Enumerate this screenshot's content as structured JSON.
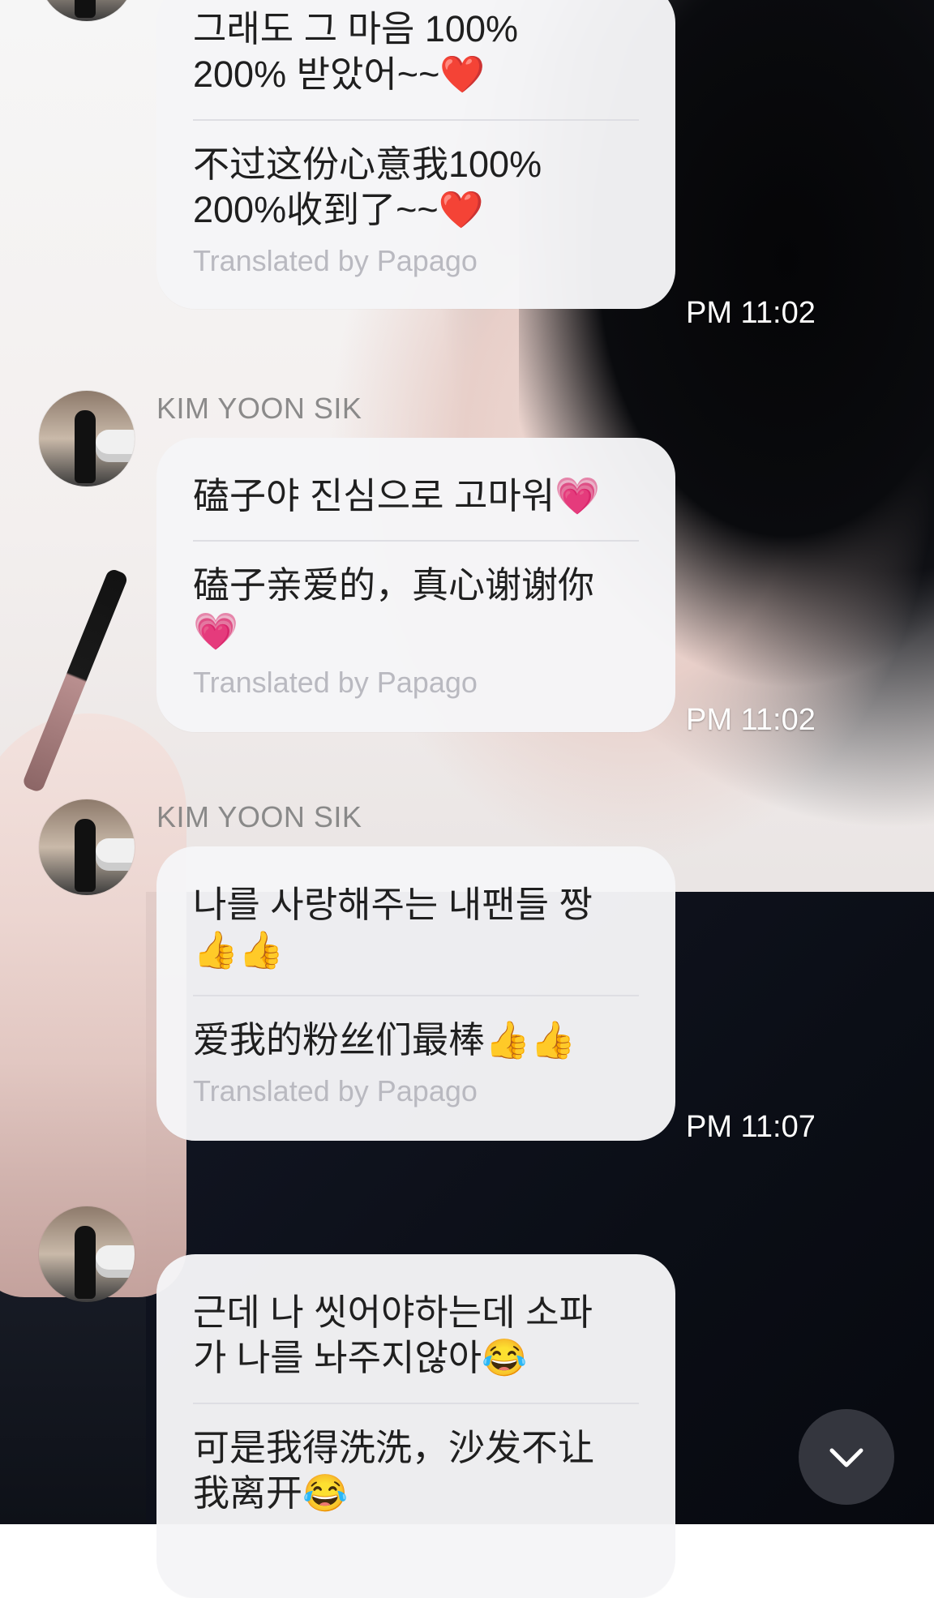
{
  "messages": [
    {
      "sender": "",
      "original": "그래도 그 마음 100%\n200% 받았어~~❤️",
      "translation": "不过这份心意我100%\n200%收到了~~❤️",
      "translated_by": "Translated by Papago",
      "time": "PM 11:02"
    },
    {
      "sender": "KIM YOON SIK",
      "original": "磕子야 진심으로 고마워💗",
      "translation": "磕子亲爱的，真心谢谢你\n💗",
      "translated_by": "Translated by Papago",
      "time": "PM 11:02"
    },
    {
      "sender": "KIM YOON SIK",
      "original": "나를 사랑해주는 내팬들 짱\n👍👍",
      "translation": "爱我的粉丝们最棒👍👍",
      "translated_by": "Translated by Papago",
      "time": "PM 11:07"
    },
    {
      "sender": "",
      "original": "근데 나 씻어야하는데 소파\n가 나를 놔주지않아😂",
      "translation": "可是我得洗洗，沙发不让\n我离开😂",
      "translated_by": "",
      "time": ""
    }
  ],
  "controls": {
    "scroll_down_icon": "chevron-down-icon"
  }
}
